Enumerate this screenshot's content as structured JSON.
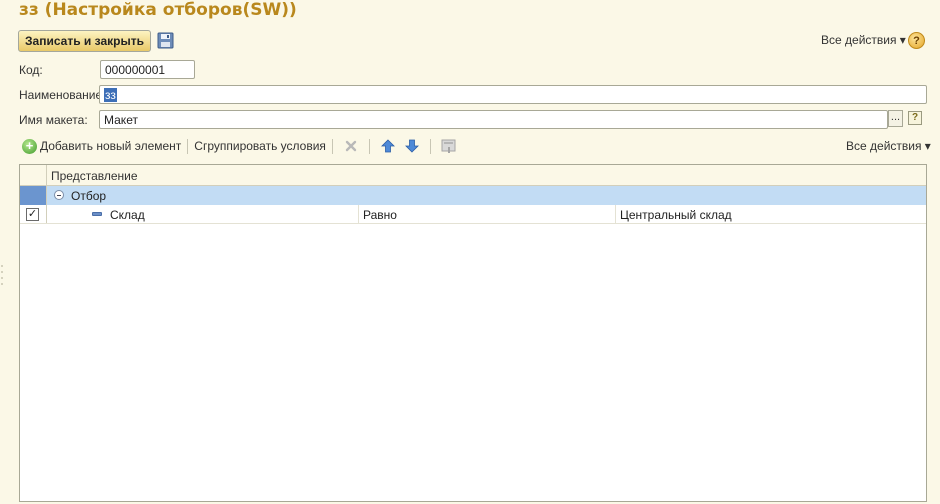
{
  "window": {
    "title": "зз (Настройка отборов(SW))"
  },
  "command_bar": {
    "save_close_label": "Записать и закрыть",
    "save_icon": "floppy-disk-icon",
    "all_actions_label": "Все действия ▾",
    "help_label": "?"
  },
  "form": {
    "code_label": "Код:",
    "code_value": "000000001",
    "name_label": "Наименование:",
    "name_value": "зз",
    "layout_label": "Имя макета:",
    "layout_value": "Макет",
    "choice_button": "...",
    "help_label": "?"
  },
  "filter_toolbar": {
    "add_label": "Добавить новый элемент",
    "group_label": "Сгруппировать условия",
    "delete_icon": "delete-x-icon",
    "up_icon": "arrow-up-icon",
    "down_icon": "arrow-down-icon",
    "properties_icon": "properties-icon",
    "all_actions_label": "Все действия ▾"
  },
  "grid": {
    "header": "Представление",
    "rows": [
      {
        "label": "Отбор",
        "type": "group",
        "selected": true
      },
      {
        "label": "Склад",
        "condition": "Равно",
        "value": "Центральный склад",
        "checked": true
      }
    ]
  },
  "colors": {
    "title": "#b9881d",
    "selection": "#c2dcf4",
    "background": "#fbf8e7"
  }
}
